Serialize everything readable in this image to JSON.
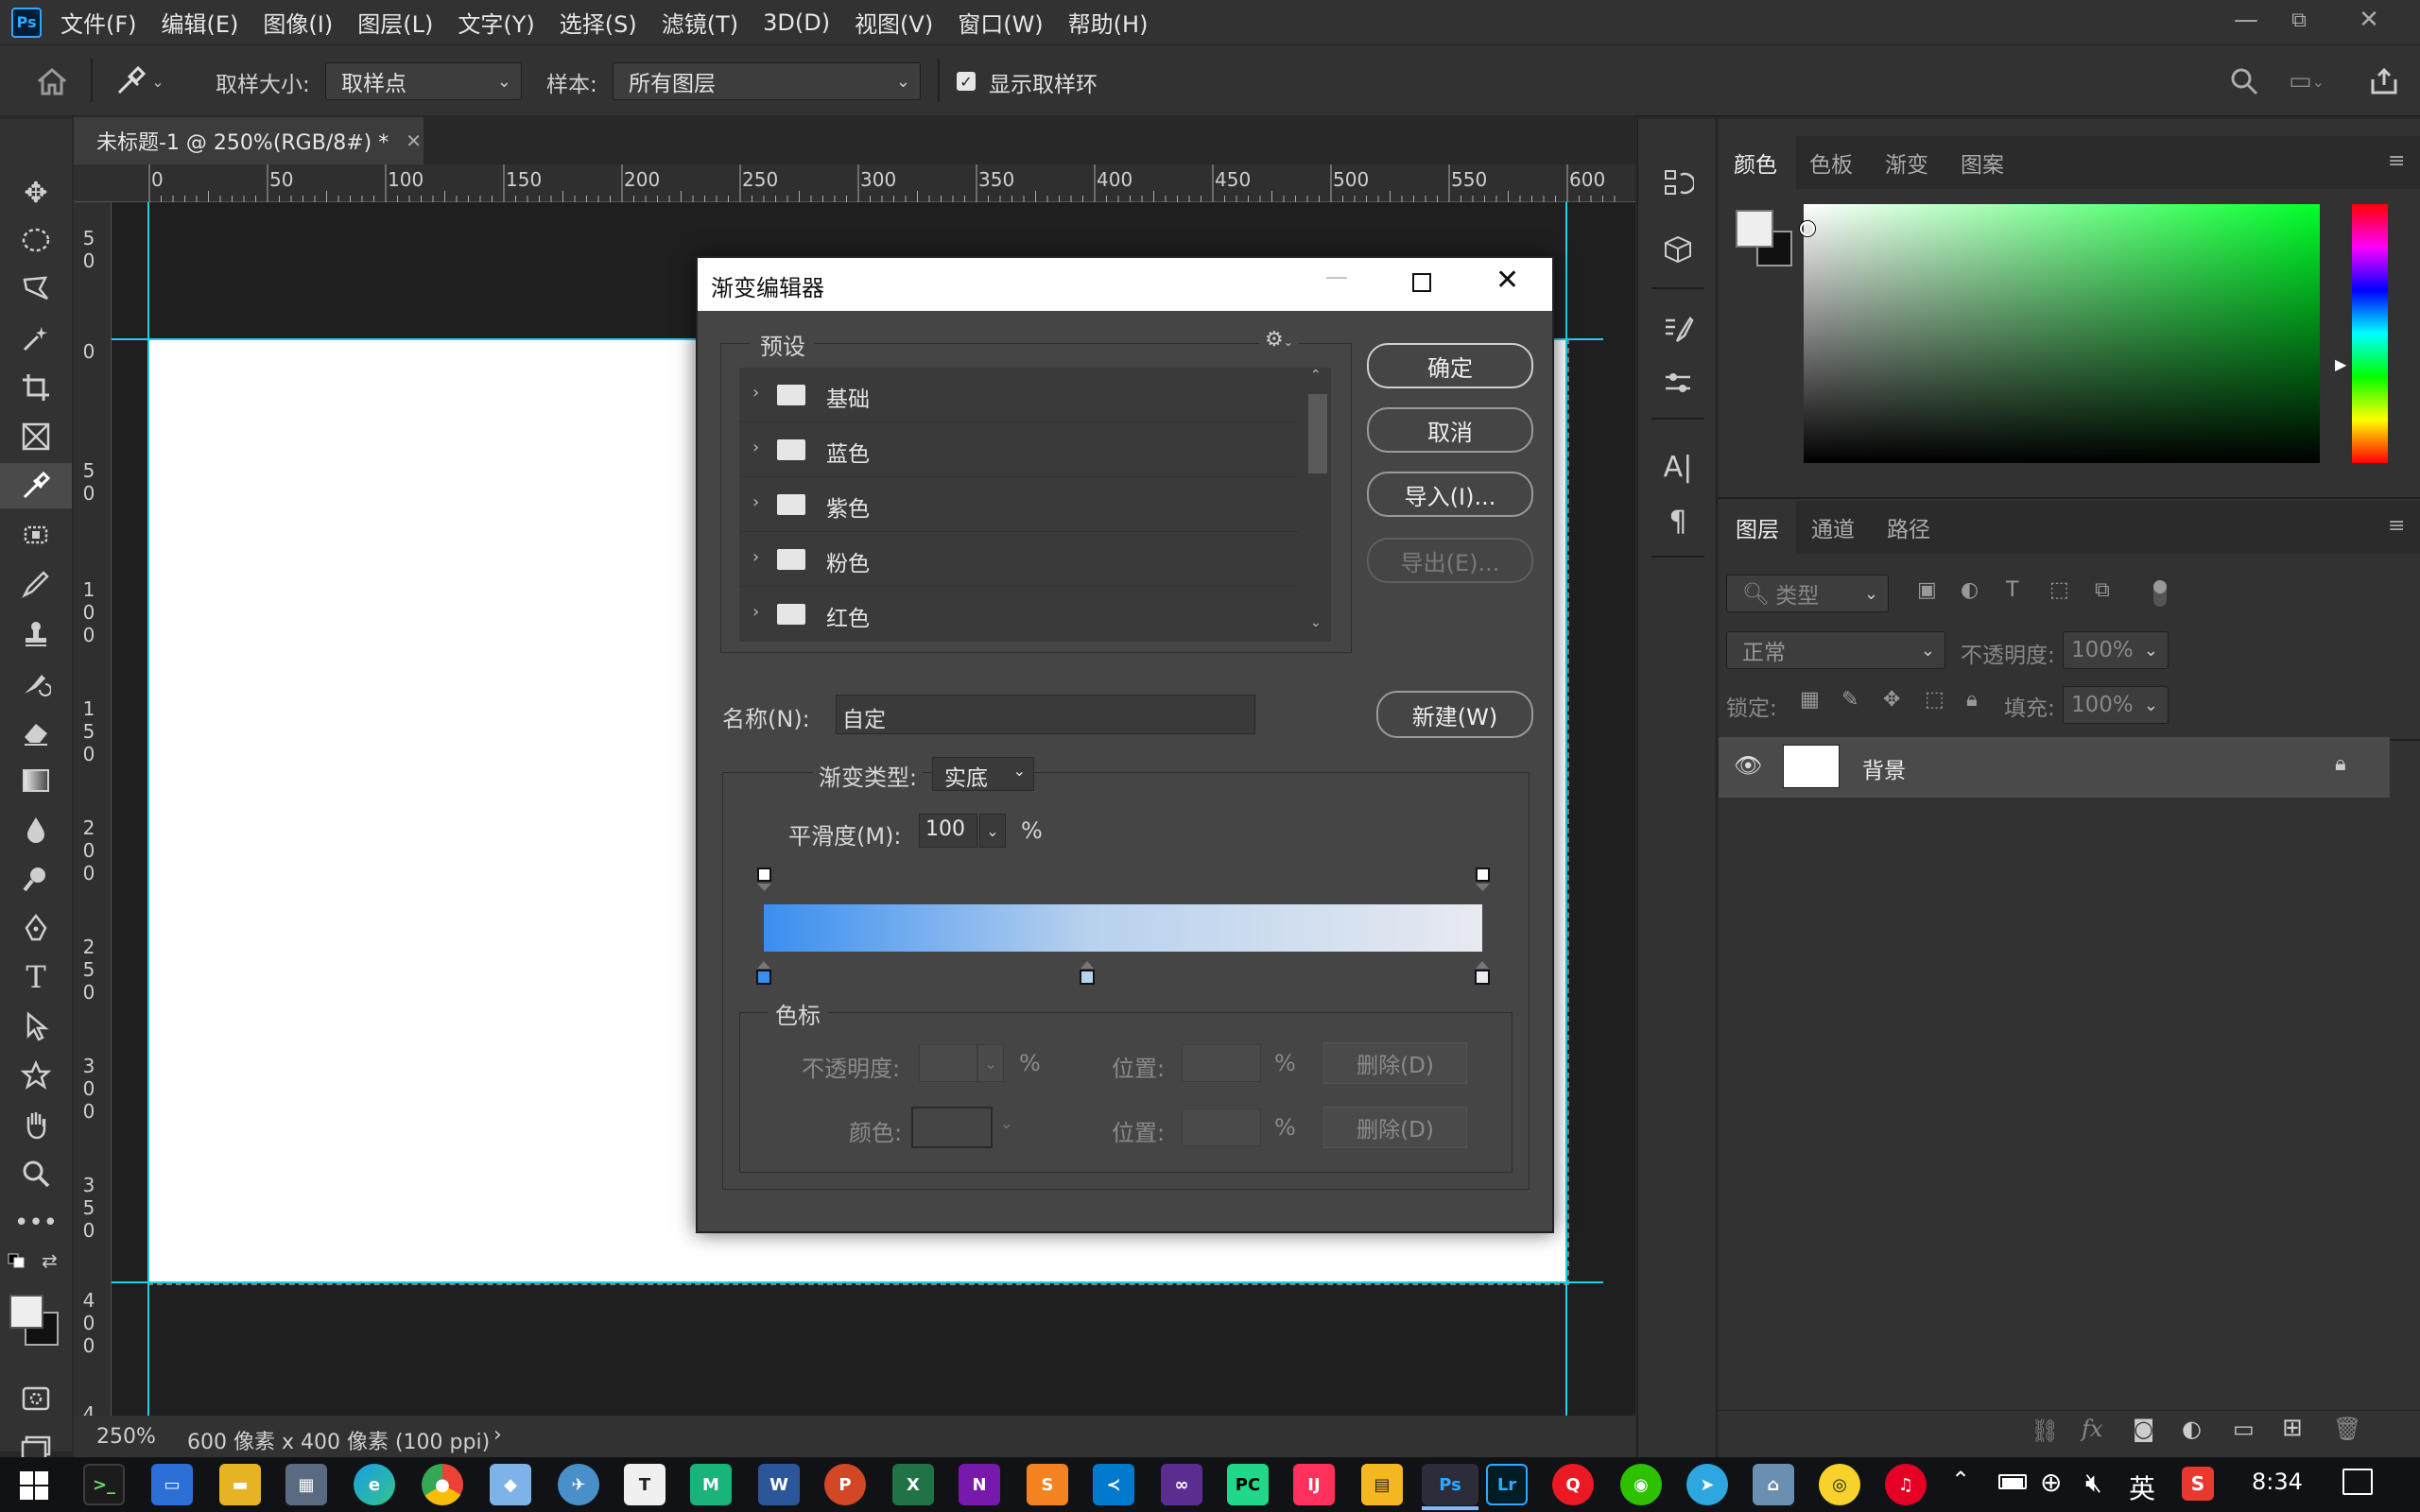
{
  "app": {
    "logo": "Ps",
    "menu": [
      "文件(F)",
      "编辑(E)",
      "图像(I)",
      "图层(L)",
      "文字(Y)",
      "选择(S)",
      "滤镜(T)",
      "3D(D)",
      "视图(V)",
      "窗口(W)",
      "帮助(H)"
    ]
  },
  "options": {
    "sample_size_label": "取样大小:",
    "sample_size_value": "取样点",
    "sample_label": "样本:",
    "sample_value": "所有图层",
    "show_ring_label": "显示取样环"
  },
  "document": {
    "tab_title": "未标题-1 @ 250%(RGB/8#) *",
    "ruler_top": [
      "0",
      "50",
      "100",
      "150",
      "200",
      "250",
      "300",
      "350",
      "400",
      "450",
      "500",
      "550",
      "600"
    ],
    "ruler_left": [
      "5\n0",
      "0",
      "5\n0",
      "1\n0\n0",
      "1\n5\n0",
      "2\n0\n0",
      "2\n5\n0",
      "3\n0\n0",
      "3\n5\n0",
      "4\n0\n0",
      "4"
    ],
    "zoom": "250%",
    "size_info": "600 像素 x 400 像素 (100 ppi)"
  },
  "color_panel": {
    "tabs": [
      "颜色",
      "色板",
      "渐变",
      "图案"
    ]
  },
  "layers_panel": {
    "tabs": [
      "图层",
      "通道",
      "路径"
    ],
    "filter_placeholder": "类型",
    "blend_mode": "正常",
    "opacity_label": "不透明度:",
    "opacity_value": "100%",
    "lock_label": "锁定:",
    "fill_label": "填充:",
    "fill_value": "100%",
    "layer_name": "背景"
  },
  "dialog": {
    "title": "渐变编辑器",
    "presets_label": "预设",
    "presets": [
      "基础",
      "蓝色",
      "紫色",
      "粉色",
      "红色"
    ],
    "ok": "确定",
    "cancel": "取消",
    "import": "导入(I)...",
    "export": "导出(E)...",
    "name_label": "名称(N):",
    "name_value": "自定",
    "new": "新建(W)",
    "gradient_type_label": "渐变类型:",
    "gradient_type_value": "实底",
    "smoothness_label": "平滑度(M):",
    "smoothness_value": "100",
    "percent": "%",
    "stops_label": "色标",
    "opacity_label": "不透明度:",
    "color_label": "颜色:",
    "location_label": "位置:",
    "delete": "删除(D)",
    "gradient_colors": [
      "#3a8ef0",
      "#b7d1ee",
      "#e8eaf0"
    ],
    "color_stop_locations_pct": [
      0,
      45,
      100
    ]
  },
  "taskbar": {
    "tray_ime": "英",
    "time": "8:34"
  }
}
